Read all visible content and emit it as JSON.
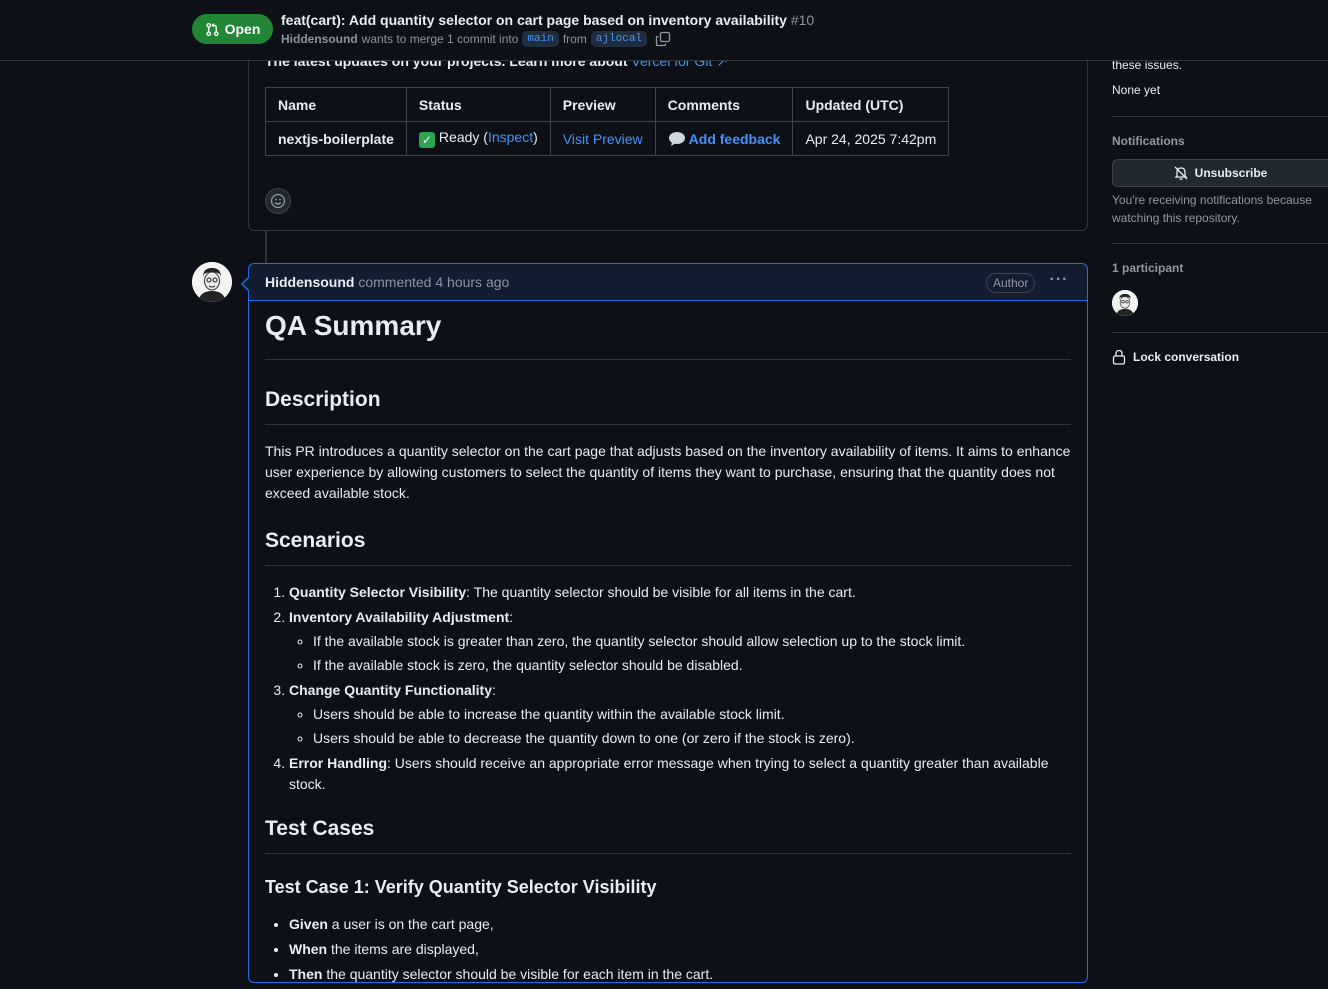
{
  "header": {
    "state_label": "Open",
    "title": "feat(cart): Add quantity selector on cart page based on inventory availability",
    "number": "#10",
    "author": "Hiddensound",
    "merge_text": "wants to merge 1 commit into",
    "base_branch": "main",
    "from_text": "from",
    "head_branch": "ajlocal"
  },
  "vercel": {
    "cut_text": "The latest updates on your projects. Learn more about",
    "cut_link": "Vercel for Git ↗",
    "columns": [
      "Name",
      "Status",
      "Preview",
      "Comments",
      "Updated (UTC)"
    ],
    "row": {
      "name": "nextjs-boilerplate",
      "status_prefix": "Ready (",
      "status_link": "Inspect",
      "status_suffix": ")",
      "preview": "Visit Preview",
      "comments": "Add feedback",
      "updated": "Apr 24, 2025 7:42pm"
    }
  },
  "comment": {
    "author": "Hiddensound",
    "meta": "commented 4 hours ago",
    "badge": "Author",
    "h1": "QA Summary",
    "description_heading": "Description",
    "description": "This PR introduces a quantity selector on the cart page that adjusts based on the inventory availability of items. It aims to enhance user experience by allowing customers to select the quantity of items they want to purchase, ensuring that the quantity does not exceed available stock.",
    "scenarios_heading": "Scenarios",
    "scenarios": [
      {
        "title": "Quantity Selector Visibility",
        "text": ": The quantity selector should be visible for all items in the cart."
      },
      {
        "title": "Inventory Availability Adjustment",
        "text": ":",
        "sub": [
          "If the available stock is greater than zero, the quantity selector should allow selection up to the stock limit.",
          "If the available stock is zero, the quantity selector should be disabled."
        ]
      },
      {
        "title": "Change Quantity Functionality",
        "text": ":",
        "sub": [
          "Users should be able to increase the quantity within the available stock limit.",
          "Users should be able to decrease the quantity down to one (or zero if the stock is zero)."
        ]
      },
      {
        "title": "Error Handling",
        "text": ": Users should receive an appropriate error message when trying to select a quantity greater than available stock."
      }
    ],
    "test_cases_heading": "Test Cases",
    "test_case_1_heading": "Test Case 1: Verify Quantity Selector Visibility",
    "test_case_1_steps": [
      {
        "keyword": "Given",
        "text": " a user is on the cart page,"
      },
      {
        "keyword": "When",
        "text": " the items are displayed,"
      },
      {
        "keyword": "Then",
        "text": " the quantity selector should be visible for each item in the cart."
      }
    ]
  },
  "sidebar": {
    "cut_text": "these issues.",
    "none_yet": "None yet",
    "notifications_heading": "Notifications",
    "unsubscribe": "Unsubscribe",
    "notif_line1": "You're receiving notifications because",
    "notif_line2": "watching this repository.",
    "participants_heading": "1 participant",
    "lock": "Lock conversation"
  }
}
